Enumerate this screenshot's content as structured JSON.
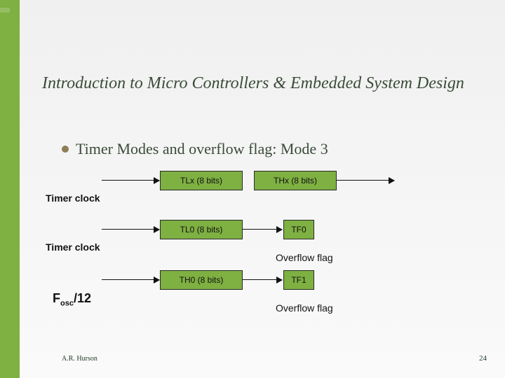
{
  "title": "Introduction to Micro Controllers & Embedded System Design",
  "bullet": {
    "text": "Timer Modes and overflow flag: Mode 3"
  },
  "diagram": {
    "row1": {
      "clock_label": "Timer clock",
      "tlx": "TLx (8 bits)",
      "thx": "THx (8 bits)"
    },
    "row2": {
      "clock_label": "Timer clock",
      "tl0": "TL0 (8 bits)",
      "tf0": "TF0",
      "overflow": "Overflow flag"
    },
    "row3": {
      "fosc": "F",
      "fosc_sub": "osc",
      "fosc_div": "/12",
      "th0": "TH0 (8 bits)",
      "tf1": "TF1",
      "overflow": "Overflow flag"
    }
  },
  "footer": {
    "author": "A.R. Hurson",
    "slide": "24"
  }
}
